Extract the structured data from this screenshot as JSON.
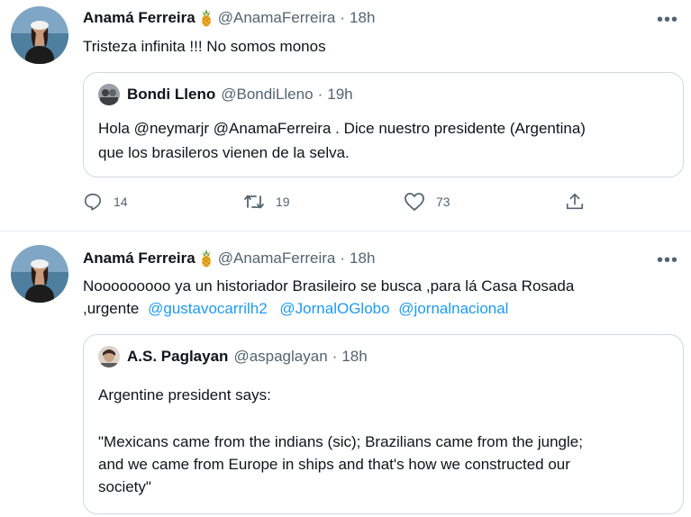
{
  "tweets": [
    {
      "name": "Anamá Ferreira",
      "handle": "@AnamaFerreira",
      "separator": "·",
      "time": "18h",
      "more": "•••",
      "text": "Tristeza infinita !!! No somos monos",
      "quote": {
        "name": "Bondi Lleno",
        "handle": "@BondiLleno",
        "separator": "·",
        "time": "19h",
        "line1": "Hola @neymarjr @AnamaFerreira . Dice nuestro presidente (Argentina)",
        "line2": "que los brasileros vienen de la selva."
      },
      "actions": {
        "reply_icon": "reply-icon",
        "reply_count": "14",
        "retweet_icon": "retweet-icon",
        "retweet_count": "19",
        "like_icon": "heart-icon",
        "like_count": "73",
        "share_icon": "share-icon"
      }
    },
    {
      "name": "Anamá Ferreira",
      "handle": "@AnamaFerreira",
      "separator": "·",
      "time": "18h",
      "more": "•••",
      "line1": "Nooooooooo ya un historiador Brasileiro  se busca ,para lá Casa Rosada",
      "line2_plain": ",urgente",
      "mentions": [
        "@gustavocarrilh2",
        "@JornalOGlobo",
        "@jornalnacional"
      ],
      "quote": {
        "name": "A.S. Paglayan",
        "handle": "@aspaglayan",
        "separator": "·",
        "time": "18h",
        "line1": "Argentine president says:",
        "line2": "\"Mexicans came from the indians (sic); Brazilians came from the jungle;",
        "line3": "and we came from Europe in ships and that's how we constructed our",
        "line4": "society\""
      }
    }
  ],
  "colors": {
    "accent": "#1d9bf0",
    "secondary_text": "#536471",
    "border": "#cfd9de"
  }
}
